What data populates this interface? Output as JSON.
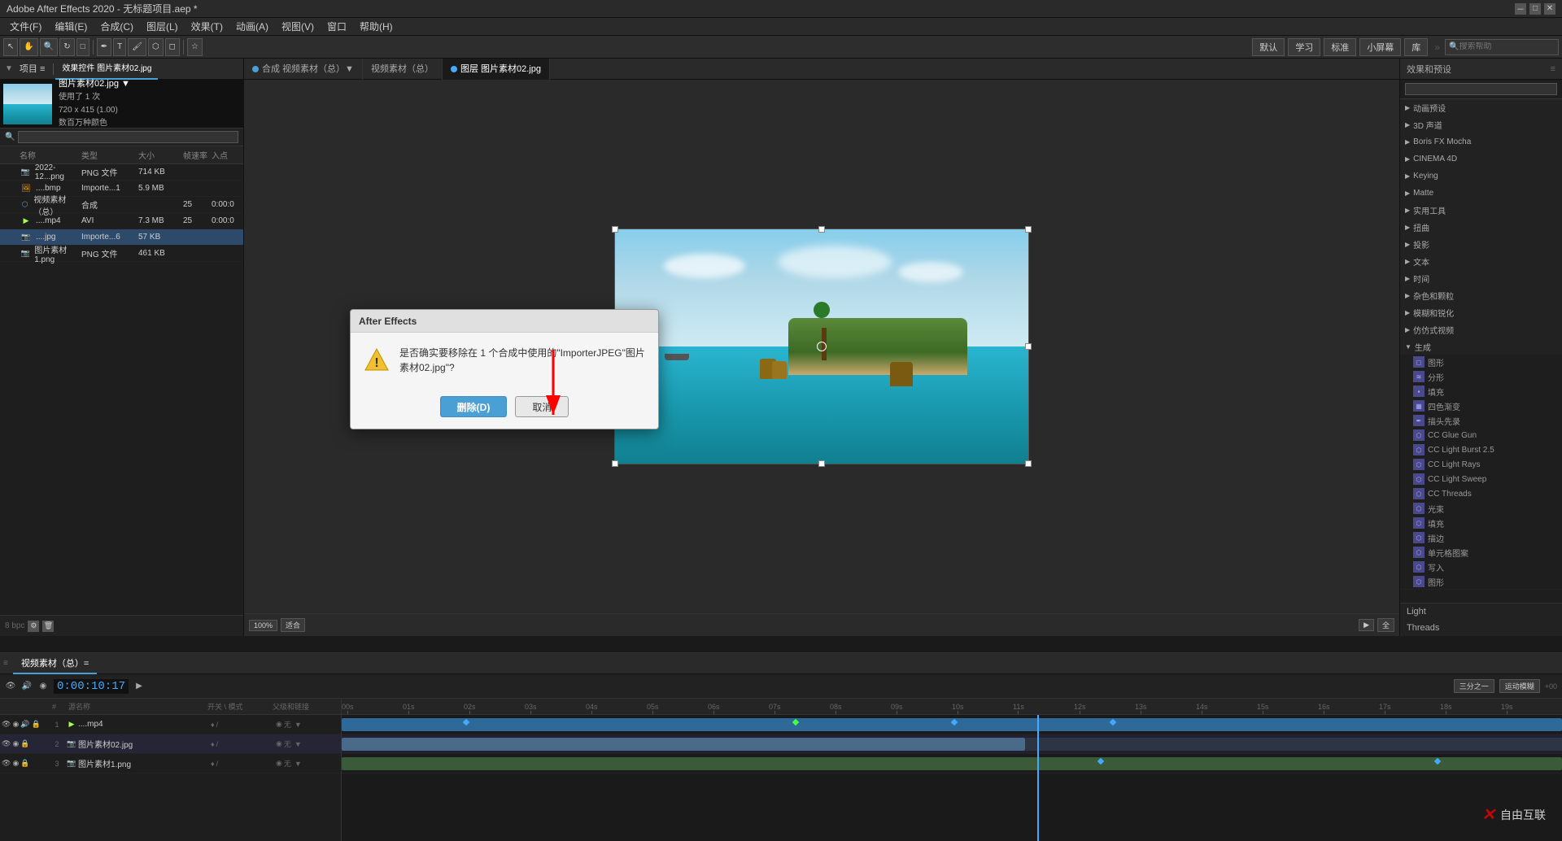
{
  "app": {
    "title": "Adobe After Effects 2020 - 无标题项目.aep *",
    "version": "Adobe After Effects 2020"
  },
  "titlebar": {
    "title": "Adobe After Effects 2020 - 无标题项目.aep *",
    "minimize": "－",
    "restore": "□",
    "close": "✕"
  },
  "menubar": {
    "items": [
      "文件(F)",
      "编辑(E)",
      "合成(C)",
      "图层(L)",
      "效果(T)",
      "动画(A)",
      "视图(V)",
      "窗口",
      "帮助(H)"
    ]
  },
  "toolbar": {
    "workspace_buttons": [
      "默认",
      "学习",
      "标准",
      "小屏幕",
      "库"
    ],
    "search_placeholder": "搜索帮助"
  },
  "project_panel": {
    "tab": "效果控件 图片素材02.jpg",
    "preview": {
      "filename": "图片素材02.jpg ▼",
      "usage": "使用了 1 次",
      "dimensions": "720 x 415 (1.00)",
      "description": "数百万种颜色"
    },
    "search_placeholder": "",
    "columns": {
      "name": "名称",
      "type": "类型",
      "size": "大小",
      "rate": "帧速率",
      "in": "入点"
    },
    "files": [
      {
        "name": "2022-12...png",
        "icon": "png",
        "type": "PNG 文件",
        "size": "714 KB",
        "rate": "",
        "in": ""
      },
      {
        "name": "....bmp",
        "icon": "bmp",
        "type": "Importe...1",
        "size": "5.9 MB",
        "rate": "",
        "in": ""
      },
      {
        "name": "视频素材（总）",
        "icon": "comp",
        "type": "合成",
        "size": "",
        "rate": "25",
        "in": "0:00:0"
      },
      {
        "name": "....mp4",
        "icon": "video",
        "type": "AVI",
        "size": "7.3 MB",
        "rate": "25",
        "in": "0:00:0"
      },
      {
        "name": "....jpg",
        "icon": "jpg",
        "type": "Importe...6",
        "size": "57 KB",
        "rate": "",
        "in": "",
        "selected": true
      },
      {
        "name": "图片素材1.png",
        "icon": "png",
        "type": "PNG 文件",
        "size": "461 KB",
        "rate": "",
        "in": ""
      }
    ]
  },
  "composition_tabs": [
    {
      "label": "合成 视频素材（总）▼",
      "indicator_color": "#4a9fd4",
      "active": false
    },
    {
      "label": "视频素材（总）",
      "active": false
    },
    {
      "label": "图层 图片素材02.jpg",
      "active": true
    }
  ],
  "timeline": {
    "tab": "视频素材（总）=",
    "timecode": "0:00:10:17",
    "layers": [
      {
        "num": "1",
        "name": "....mp4",
        "icon": "video",
        "switches": [
          "♦",
          "/"
        ],
        "parent": "无",
        "bar_start": 0,
        "bar_end": 100,
        "bar_type": "video"
      },
      {
        "num": "2",
        "name": "图片素材02.jpg",
        "icon": "img",
        "switches": [
          "♦",
          "/"
        ],
        "parent": "无",
        "bar_start": 0,
        "bar_end": 57,
        "bar_type": "image",
        "selected": true
      },
      {
        "num": "3",
        "name": "图片素材1.png",
        "icon": "img",
        "switches": [
          "♦",
          "/"
        ],
        "parent": "无",
        "bar_start": 0,
        "bar_end": 100,
        "bar_type": "image2"
      }
    ],
    "ruler_marks": [
      "00s",
      "01s",
      "02s",
      "03s",
      "04s",
      "05s",
      "06s",
      "07s",
      "08s",
      "09s",
      "10s",
      "11s",
      "12s",
      "13s",
      "14s",
      "15s",
      "16s",
      "17s",
      "18s",
      "19s"
    ],
    "playhead_position": "57"
  },
  "effects_panel": {
    "title": "效果和预设",
    "search_placeholder": "",
    "groups": [
      {
        "name": "动画预设",
        "expanded": false
      },
      {
        "name": "3D 声道",
        "expanded": false
      },
      {
        "name": "Boris FX Mocha",
        "expanded": false
      },
      {
        "name": "CINEMA 4D",
        "expanded": false
      },
      {
        "name": "Keying",
        "expanded": false
      },
      {
        "name": "Matte",
        "expanded": false
      },
      {
        "name": "实用工具",
        "expanded": false
      },
      {
        "name": "扭曲",
        "expanded": false
      },
      {
        "name": "投影",
        "expanded": false
      },
      {
        "name": "文本",
        "expanded": false
      },
      {
        "name": "时间",
        "expanded": false
      },
      {
        "name": "杂色和颗粒",
        "expanded": false
      },
      {
        "name": "模糊和锐化",
        "expanded": false
      },
      {
        "name": "仿仿式视频",
        "expanded": false
      },
      {
        "name": "生成",
        "expanded": true,
        "items": [
          {
            "name": "图形",
            "icon": "shape"
          },
          {
            "name": "分形",
            "icon": "fractal"
          },
          {
            "name": "填充",
            "icon": "fill"
          },
          {
            "name": "四色渐变",
            "icon": "gradient"
          },
          {
            "name": "描头先录",
            "icon": "stroke"
          },
          {
            "name": "CC Glue Gun",
            "icon": "cc"
          },
          {
            "name": "CC Light Burst 2.5",
            "icon": "cc"
          },
          {
            "name": "CC Light Rays",
            "icon": "cc"
          },
          {
            "name": "CC Light Sweep",
            "icon": "cc"
          },
          {
            "name": "CC Threads",
            "icon": "cc"
          },
          {
            "name": "光束",
            "icon": "beam"
          },
          {
            "name": "填充",
            "icon": "fill"
          },
          {
            "name": "描边",
            "icon": "stroke"
          },
          {
            "name": "单元格图案",
            "icon": "cell"
          },
          {
            "name": "写入",
            "icon": "write"
          },
          {
            "name": "图形",
            "icon": "shape"
          }
        ]
      }
    ],
    "light_label": "Light",
    "threads_label": "Threads"
  },
  "dialog": {
    "title": "After Effects",
    "message": "是否确实要移除在 1 个合成中使用的\"ImporterJPEG\"图片素材02.jpg\"?",
    "confirm_btn": "删除(D)",
    "cancel_btn": "取消"
  },
  "watermark": {
    "text": "自由互联",
    "icon": "X"
  }
}
